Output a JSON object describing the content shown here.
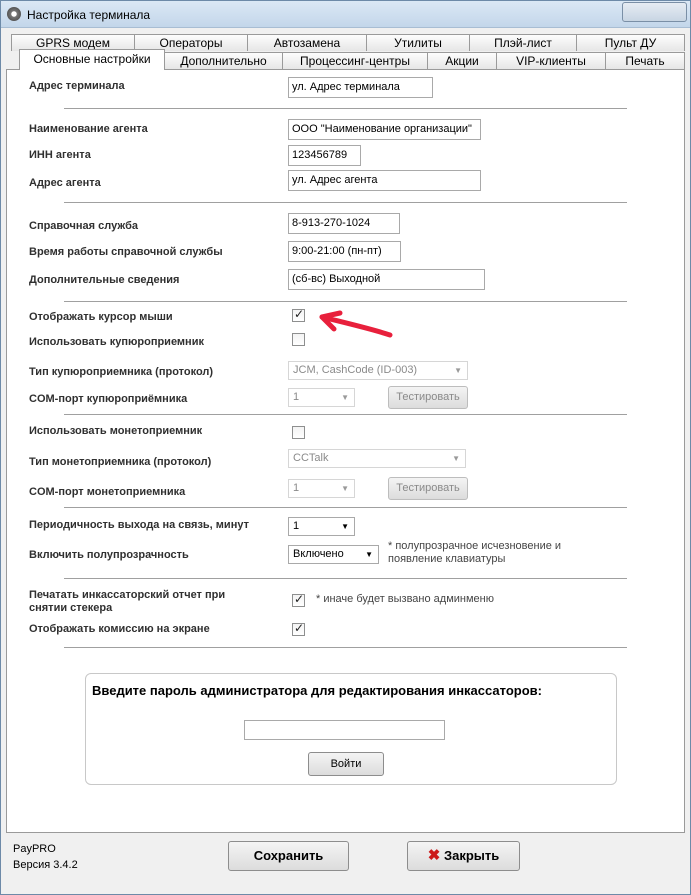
{
  "window": {
    "title": "Настройка терминала"
  },
  "tabs_row1": [
    "GPRS модем",
    "Операторы",
    "Автозамена",
    "Утилиты",
    "Плэй-лист",
    "Пульт ДУ"
  ],
  "tabs_row2": [
    "Основные настройки",
    "Дополнительно",
    "Процессинг-центры",
    "Акции",
    "VIP-клиенты",
    "Печать"
  ],
  "fields": {
    "terminal_address": {
      "label": "Адрес терминала",
      "value": "ул. Адрес терминала"
    },
    "agent_name": {
      "label": "Наименование агента",
      "value": "ООО \"Наименование организации\""
    },
    "agent_inn": {
      "label": "ИНН агента",
      "value": "123456789"
    },
    "agent_address": {
      "label": "Адрес агента",
      "value": "ул. Адрес агента"
    },
    "help_service": {
      "label": "Справочная служба",
      "value": "8-913-270-1024"
    },
    "help_hours": {
      "label": "Время работы справочной службы",
      "value": "9:00-21:00 (пн-пт)"
    },
    "extra_info": {
      "label": "Дополнительные сведения",
      "value": "(сб-вс)  Выходной"
    }
  },
  "options": {
    "show_cursor": {
      "label": "Отображать курсор мыши",
      "checked": true
    },
    "use_bill": {
      "label": "Использовать купюроприемник",
      "checked": false
    },
    "bill_type": {
      "label": "Тип купюроприемника (протокол)",
      "value": "JCM, CashCode (ID-003)"
    },
    "bill_com": {
      "label": "COM-порт купюроприёмника",
      "value": "1",
      "test": "Тестировать"
    },
    "use_coin": {
      "label": "Использовать монетоприемник",
      "checked": false
    },
    "coin_type": {
      "label": "Тип монетоприемника (протокол)",
      "value": "CCTalk"
    },
    "coin_com": {
      "label": "COM-порт монетоприемника",
      "value": "1",
      "test": "Тестировать"
    },
    "period": {
      "label": "Периодичность выхода на связь, минут",
      "value": "1"
    },
    "transparency": {
      "label": "Включить полупрозрачность",
      "value": "Включено",
      "note": "* полупрозрачное исчезновение и появление клавиатуры"
    },
    "collection_report": {
      "label": "Печатать инкассаторский отчет при снятии стекера",
      "checked": true,
      "note": "* иначе будет вызвано админменю"
    },
    "show_commission": {
      "label": "Отображать комиссию на экране",
      "checked": true
    }
  },
  "password": {
    "title": "Введите пароль администратора для редактирования инкассаторов:",
    "value": "",
    "login": "Войти"
  },
  "footer": {
    "app": "PayPRO",
    "version": "Версия 3.4.2",
    "save": "Сохранить",
    "close": "Закрыть"
  },
  "colors": {
    "arrow": "#e8203c",
    "close_icon": "#cc1a1a"
  }
}
